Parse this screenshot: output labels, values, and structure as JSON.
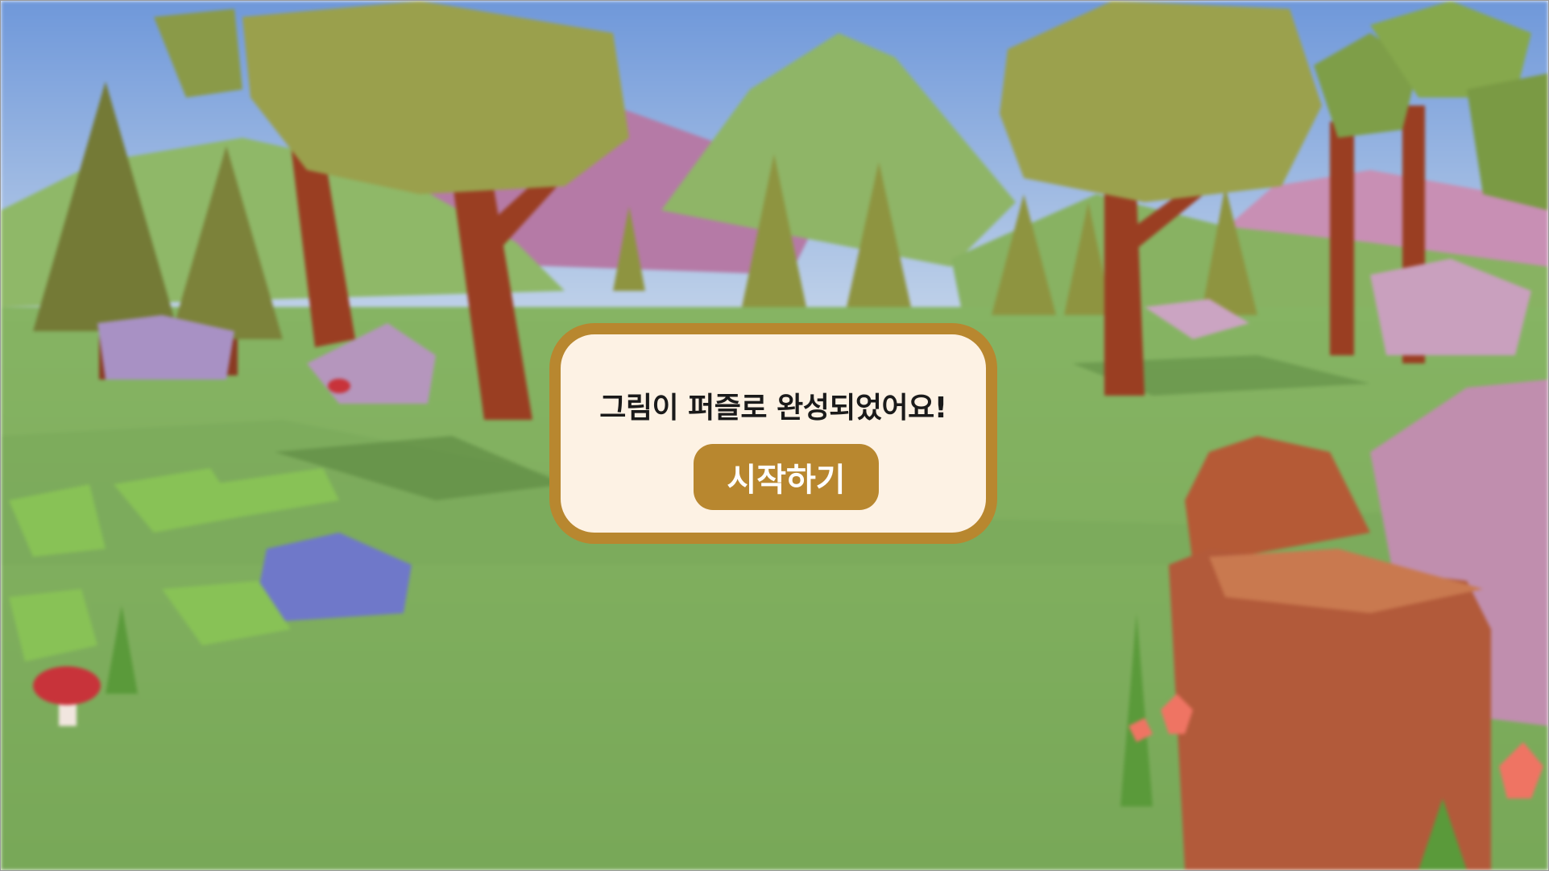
{
  "scene": {
    "icon": "low-poly-forest-scene",
    "colors": {
      "sky_top": "#7fa6df",
      "sky_bottom": "#b9cde6",
      "grass": "#7fad5c",
      "mountain": "#b57aa6",
      "trunk": "#9a3e22",
      "foliage": "#98a04a"
    }
  },
  "dialog": {
    "message": "그림이 퍼즐로 완성되었어요!",
    "start_button_label": "시작하기",
    "colors": {
      "panel_background": "#fdf2e4",
      "panel_border": "#b8872f",
      "button_background": "#b8872f",
      "button_text": "#ffffff",
      "message_text": "#1a1a1a"
    }
  }
}
